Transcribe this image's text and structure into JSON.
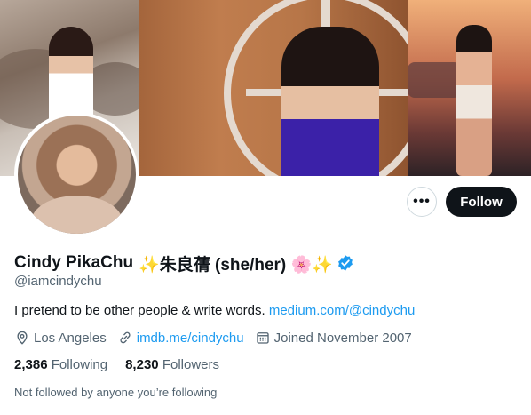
{
  "profile": {
    "name": "Cindy PikaChu",
    "name_suffix": "✨朱良蒨 (she/her) 🌸✨",
    "handle": "@iamcindychu",
    "bio_text": "I pretend to be other people & write words.",
    "bio_link": "medium.com/@cindychu",
    "location": "Los Angeles",
    "website": "imdb.me/cindychu",
    "joined": "Joined November 2007",
    "following_count": "2,386",
    "following_label": "Following",
    "followers_count": "8,230",
    "followers_label": "Followers",
    "not_followed_note": "Not followed by anyone you’re following"
  },
  "actions": {
    "more_label": "•••",
    "follow_label": "Follow"
  },
  "icons": {
    "more": "more-icon",
    "verified": "verified-badge-icon",
    "location": "location-pin-icon",
    "link": "link-icon",
    "calendar": "calendar-icon"
  },
  "colors": {
    "accent": "#1d9bf0",
    "text_primary": "#0f1419",
    "text_secondary": "#536471",
    "follow_button": "#0f1419"
  }
}
